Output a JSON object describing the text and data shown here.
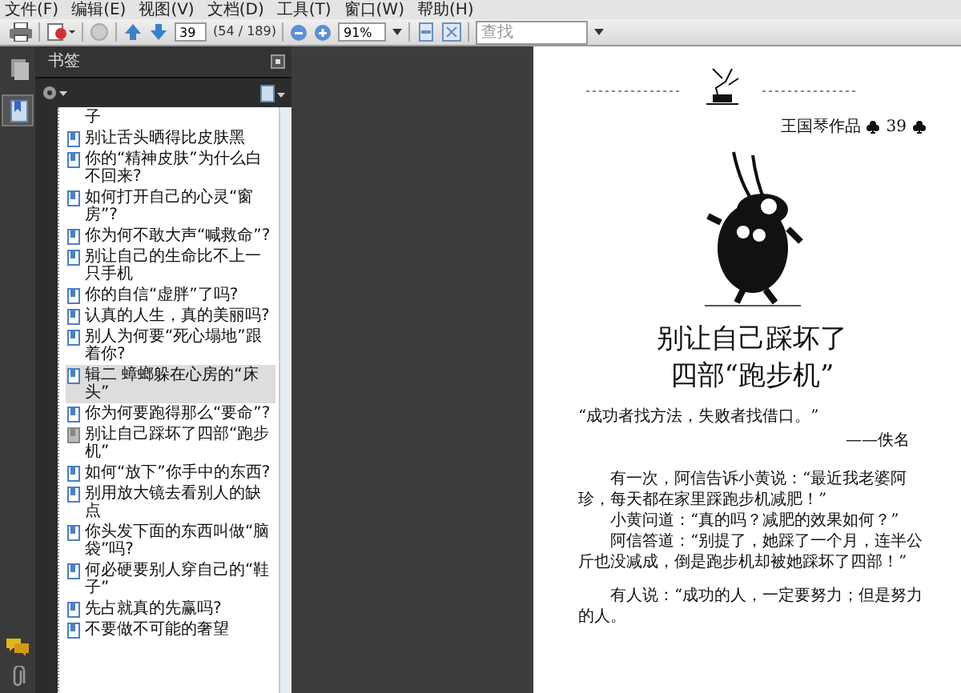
{
  "menu": [
    "文件(F)",
    "编辑(E)",
    "视图(V)",
    "文档(D)",
    "工具(T)",
    "窗口(W)",
    "帮助(H)"
  ],
  "toolbar": {
    "page_number": "39",
    "page_count": "(54 / 189)",
    "zoom": "91%",
    "search": {
      "placeholder": "查找"
    }
  },
  "sidebar": {
    "tabs": [
      {
        "kind": "pages",
        "selected": false
      },
      {
        "kind": "bookmarks",
        "selected": true
      }
    ]
  },
  "bookmarks": {
    "title": "书签",
    "items": [
      {
        "kind": "continuation",
        "text": "子",
        "selected": false
      },
      {
        "kind": "bookmark",
        "text": "别让舌头晒得比皮肤黑",
        "selected": false,
        "current": false
      },
      {
        "kind": "bookmark",
        "text": "你的“精神皮肤”为什么白不回来?",
        "selected": false,
        "current": false
      },
      {
        "kind": "bookmark",
        "text": "如何打开自己的心灵“窗房”?",
        "selected": false,
        "current": false
      },
      {
        "kind": "bookmark",
        "text": "你为何不敢大声“喊救命”?",
        "selected": false,
        "current": false
      },
      {
        "kind": "bookmark",
        "text": "别让自己的生命比不上一只手机",
        "selected": false,
        "current": false
      },
      {
        "kind": "bookmark",
        "text": "你的自信“虚胖”了吗?",
        "selected": false,
        "current": false
      },
      {
        "kind": "bookmark",
        "text": "认真的人生，真的美丽吗?",
        "selected": false,
        "current": false
      },
      {
        "kind": "bookmark",
        "text": "别人为何要“死心塌地”跟着你?",
        "selected": false,
        "current": false
      },
      {
        "kind": "bookmark",
        "text": "辑二 蟑螂躲在心房的“床头”",
        "selected": true,
        "current": false
      },
      {
        "kind": "bookmark",
        "text": "你为何要跑得那么“要命”?",
        "selected": false,
        "current": false
      },
      {
        "kind": "bookmark",
        "text": "别让自己踩坏了四部“跑步机”",
        "selected": false,
        "current": true
      },
      {
        "kind": "bookmark",
        "text": "如何“放下”你手中的东西?",
        "selected": false,
        "current": false
      },
      {
        "kind": "bookmark",
        "text": "别用放大镜去看别人的缺点",
        "selected": false,
        "current": false
      },
      {
        "kind": "bookmark",
        "text": "你头发下面的东西叫做“脑袋”吗?",
        "selected": false,
        "current": false
      },
      {
        "kind": "bookmark",
        "text": "何必硬要别人穿自己的“鞋子”",
        "selected": false,
        "current": false
      },
      {
        "kind": "bookmark",
        "text": "先占就真的先赢吗?",
        "selected": false,
        "current": false
      },
      {
        "kind": "bookmark",
        "text": "不要做不可能的奢望",
        "selected": false,
        "current": false
      }
    ]
  },
  "page": {
    "running_head": "王国琴作品",
    "page_number": "39",
    "title_lines": [
      "别让自己踩坏了",
      "四部“跑步机”"
    ],
    "epigraph": "“成功者找方法，失败者找借口。”",
    "attribution": "——佚名",
    "paragraphs": [
      "有一次，阿信告诉小黄说：“最近我老婆阿珍，每天都在家里踩跑步机减肥！”",
      "小黄问道：“真的吗？减肥的效果如何？”",
      "阿信答道：“别提了，她踩了一个月，连半公斤也没减成，倒是跑步机却被她踩坏了四部！”",
      "有人说：“成功的人，一定要努力；但是努力的人。"
    ]
  }
}
